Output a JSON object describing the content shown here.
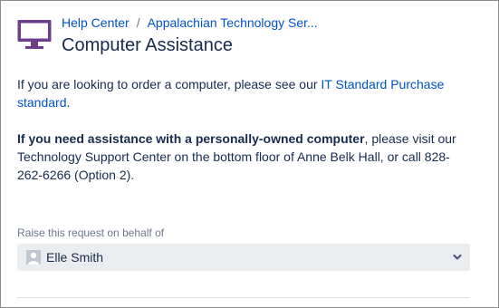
{
  "breadcrumb": {
    "items": [
      "Help Center",
      "Appalachian Technology Ser..."
    ],
    "separator": "/"
  },
  "page": {
    "title": "Computer Assistance"
  },
  "content": {
    "p1_prefix": "If you are looking to order a computer, please see our ",
    "p1_link": "IT Standard Purchase standard",
    "p1_suffix": ".",
    "p2_bold": "If you need assistance with a personally-owned computer",
    "p2_rest": ", please visit our Technology Support Center on the bottom floor of Anne Belk Hall, or call 828-262-6266 (Option 2)."
  },
  "form": {
    "behalf_label": "Raise this request on behalf of",
    "behalf_value": "Elle Smith"
  },
  "colors": {
    "accent": "#0052cc",
    "icon": "#6b3f8c",
    "field_bg": "#ebecf0"
  },
  "icons": {
    "service_icon": "monitor-icon",
    "select_icon": "chevron-down-icon",
    "avatar": "user-avatar"
  }
}
